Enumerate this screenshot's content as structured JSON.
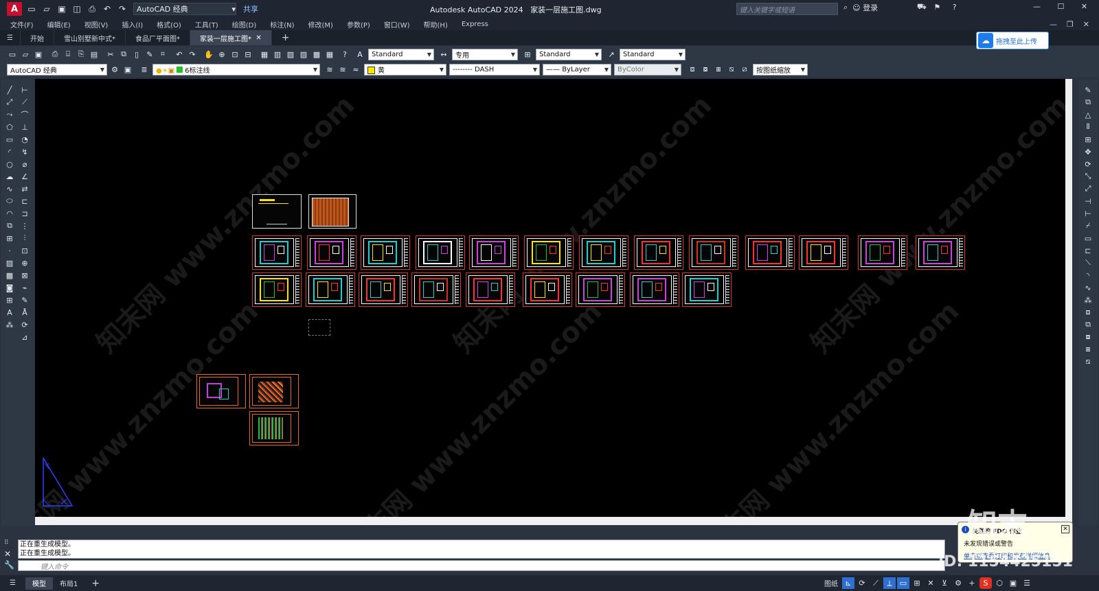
{
  "titlebar": {
    "logo": "A",
    "workspace": "AutoCAD 经典",
    "share": "共享",
    "app_title": "Autodesk AutoCAD 2024",
    "document_title": "家装一层施工图.dwg",
    "search_placeholder": "键入关键字或短语",
    "login": "登录"
  },
  "menu": [
    "文件(F)",
    "编辑(E)",
    "视图(V)",
    "插入(I)",
    "格式(O)",
    "工具(T)",
    "绘图(D)",
    "标注(N)",
    "修改(M)",
    "参数(P)",
    "窗口(W)",
    "帮助(H)",
    "Express"
  ],
  "tabs": [
    {
      "label": "开始",
      "active": false
    },
    {
      "label": "雪山别墅新中式*",
      "active": false
    },
    {
      "label": "食品厂平面图*",
      "active": false
    },
    {
      "label": "家装一层施工图*",
      "active": true
    }
  ],
  "upload_button": "拖拽至此上传",
  "toolbar1": {
    "text_style": "Standard",
    "dim_style": "专用",
    "table_style": "Standard",
    "multileader_style": "Standard"
  },
  "toolbar2": {
    "workspace": "AutoCAD 经典",
    "layer": "6标注线",
    "color": "黄",
    "linetype": "DASH",
    "lineweight": "ByLayer",
    "plotstyle": "ByColor",
    "annotation_scale": "按图纸缩放"
  },
  "colors": {
    "accent": "#2f6fd0",
    "canvas_bg": "#000000",
    "sheet_red": "#d8362d",
    "sheet_orange": "#e66b17",
    "layer_color": "#ffe600"
  },
  "canvas": {
    "watermark": "知末网 www.znzmo.com"
  },
  "command": {
    "history": [
      "正在重生成模型。",
      "正在重生成模型。"
    ],
    "placeholder": "键入命令"
  },
  "statusbar": {
    "tabs": [
      {
        "label": "模型",
        "active": true
      },
      {
        "label": "布局1",
        "active": false
      }
    ],
    "paper": "图纸"
  },
  "notification": {
    "title": "关联的 FDO 作业",
    "message": "未发现错误或警告",
    "link": "单击以查看打印和发布详细信息"
  },
  "overlay": {
    "brand": "知末",
    "id_text": "ID: 1154425151"
  }
}
